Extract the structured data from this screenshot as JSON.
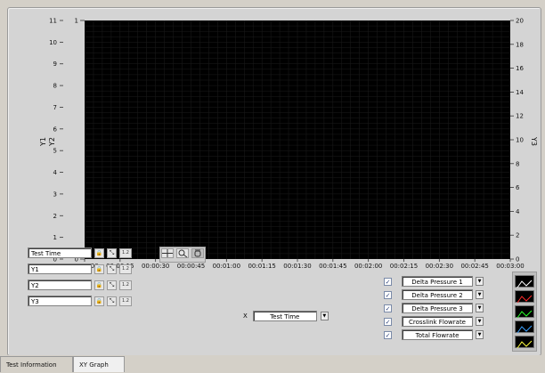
{
  "graph": {
    "y1_axis_label": "Y1",
    "y2_axis_label": "Y2",
    "y3_axis_label": "Y3",
    "left_ticks": [
      "0",
      "1",
      "2",
      "3",
      "4",
      "5",
      "6",
      "7",
      "8",
      "9",
      "10",
      "11"
    ],
    "right_ticks": [
      "0",
      "2",
      "4",
      "6",
      "8",
      "10",
      "12",
      "14",
      "16",
      "18",
      "20"
    ],
    "inner_left_ticks": [
      "0",
      "1"
    ],
    "x_ticks": [
      "00:00:00",
      "00:00:15",
      "00:00:30",
      "00:00:45",
      "00:01:00",
      "00:01:15",
      "00:01:30",
      "00:01:45",
      "00:02:00",
      "00:02:15",
      "00:02:30",
      "00:02:45",
      "00:03:00"
    ]
  },
  "scales": [
    {
      "label": "Test Time"
    },
    {
      "label": "Y1"
    },
    {
      "label": "Y2"
    },
    {
      "label": "Y3"
    }
  ],
  "x_select": {
    "label": "X",
    "value": "Test Time"
  },
  "plots": [
    {
      "name": "Delta Pressure 1",
      "checked": true,
      "color": "#ffffff"
    },
    {
      "name": "Delta Pressure 2",
      "checked": true,
      "color": "#ff2a2a"
    },
    {
      "name": "Delta Pressure 3",
      "checked": true,
      "color": "#2aff2a"
    },
    {
      "name": "Crosslink Flowrate",
      "checked": true,
      "color": "#3aa0ff"
    },
    {
      "name": "Total Flowrate",
      "checked": true,
      "color": "#ffff40"
    }
  ],
  "tabs": [
    {
      "label": "Test Information",
      "active": false
    },
    {
      "label": "XY Graph",
      "active": true
    }
  ],
  "icons": {
    "lock": "lock-icon",
    "autoscale": "autoscale-icon",
    "format": "format-icon",
    "crosshair": "crosshair-icon",
    "zoom": "zoom-icon",
    "pan": "pan-hand-icon"
  }
}
